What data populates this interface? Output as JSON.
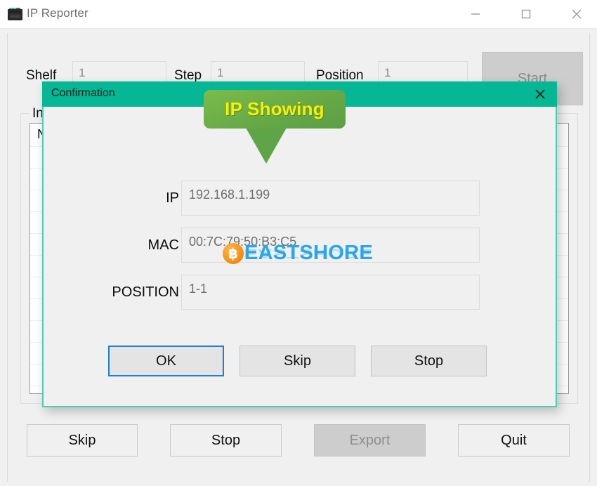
{
  "window": {
    "title": "IP Reporter",
    "icon": "app-icon",
    "controls": {
      "minimize": "minimize-icon",
      "maximize": "maximize-icon",
      "close": "close-icon"
    }
  },
  "main": {
    "fields": [
      {
        "label": "Shelf",
        "value": "1"
      },
      {
        "label": "Step",
        "value": "1"
      },
      {
        "label": "Position",
        "value": "1"
      }
    ],
    "start_button": {
      "label": "Start",
      "enabled": false
    },
    "group": {
      "legend": "Info",
      "columns": [
        "No"
      ],
      "rows": []
    },
    "buttons": [
      {
        "label": "Skip",
        "enabled": true
      },
      {
        "label": "Stop",
        "enabled": true
      },
      {
        "label": "Export",
        "enabled": false
      },
      {
        "label": "Quit",
        "enabled": true
      }
    ]
  },
  "dialog": {
    "title": "Confirmation",
    "close_icon": "close-icon",
    "callout": {
      "text": "IP Showing"
    },
    "fields": [
      {
        "label": "IP",
        "value": "192.168.1.199"
      },
      {
        "label": "MAC",
        "value": "00:7C:79:50:B3:C5"
      },
      {
        "label": "POSITION",
        "value": "1-1"
      }
    ],
    "buttons": [
      {
        "label": "OK",
        "focused": true
      },
      {
        "label": "Skip",
        "focused": false
      },
      {
        "label": "Stop",
        "focused": false
      }
    ]
  },
  "watermark": {
    "coin_glyph": "฿",
    "text": "EASTSHORE"
  },
  "colors": {
    "dialog_header": "#05b795",
    "dialog_border": "#4ecdb4",
    "callout_green": "#65a846",
    "callout_text": "#f9f000",
    "focus_blue": "#1e7fd4",
    "watermark_blue": "#29a7e8",
    "watermark_orange": "#f7931a"
  }
}
